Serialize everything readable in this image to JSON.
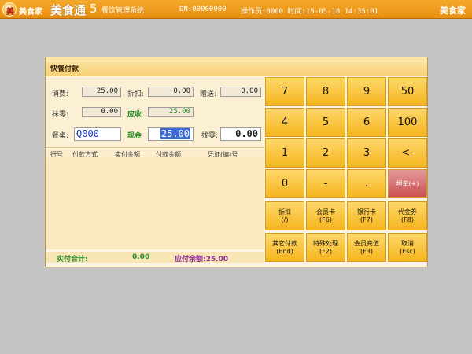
{
  "topbar": {
    "logo_text": "美食家",
    "logo_glyph": "美",
    "brand": "美食通",
    "brand_version": "5",
    "brand_subtitle": "餐饮管理系统",
    "dn": "DN:00000000",
    "operator_info": "操作员:0000 时间:15-05-18 14:35:01",
    "brand_right": "美食家"
  },
  "panel": {
    "title": "快餐付款",
    "fields": {
      "consume_label": "消费:",
      "consume_value": "25.00",
      "discount_label": "折扣:",
      "discount_value": "0.00",
      "gift_label": "赠送:",
      "gift_value": "0.00",
      "rounding_label": "抹零:",
      "rounding_value": "0.00",
      "receivable_label": "应收",
      "receivable_value": "25.00",
      "table_label": "餐桌:",
      "table_value": "Q000",
      "cash_label": "现金",
      "cash_value": "25.00",
      "change_label": "找零:",
      "change_value": "0.00"
    },
    "grid_columns": [
      "行号",
      "付款方式",
      "实付金额",
      "付款金额",
      "凭证(编)号"
    ],
    "total": {
      "paid_label": "实付合计:",
      "paid_value": "0.00",
      "balance_label": "应付余额:25.00"
    }
  },
  "keypad": {
    "k7": "7",
    "k8": "8",
    "k9": "9",
    "k50": "50",
    "k4": "4",
    "k5": "5",
    "k6": "6",
    "k100": "100",
    "k1": "1",
    "k2": "2",
    "k3": "3",
    "kback": "<-",
    "k0": "0",
    "kminus": "-",
    "kdot": ".",
    "krefund": "埋单(+)",
    "fn": {
      "discount": "折扣",
      "discount_hot": "(/)",
      "member_card": "会员卡",
      "member_card_hot": "(F6)",
      "bank_card": "银行卡",
      "bank_card_hot": "(F7)",
      "voucher": "代金券",
      "voucher_hot": "(F8)",
      "other_pay": "其它付款",
      "other_pay_hot": "(End)",
      "special": "特殊处理",
      "special_hot": "(F2)",
      "member_recharge": "会员充值",
      "member_recharge_hot": "(F3)",
      "cancel": "取消",
      "cancel_hot": "(Esc)"
    }
  },
  "colors": {
    "topbar": "#f0a020",
    "key": "#f8c23a",
    "receivable_green": "#1d8a1d",
    "balance_purple": "#8a2a9a",
    "paid_green": "#2a8f2a"
  }
}
